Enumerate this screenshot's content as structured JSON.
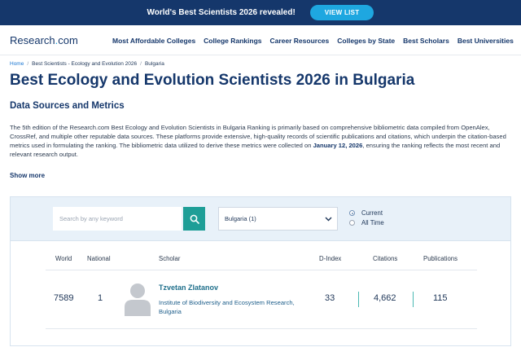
{
  "banner": {
    "text": "World's Best Scientists 2026 revealed!",
    "button_label": "VIEW LIST"
  },
  "header": {
    "logo_main": "Research",
    "logo_dot": ".",
    "logo_suffix": "com",
    "nav": [
      "Most Affordable Colleges",
      "College Rankings",
      "Career Resources",
      "Colleges by State",
      "Best Scholars",
      "Best Universities"
    ]
  },
  "breadcrumb": {
    "home": "Home",
    "separator": "/",
    "level2": "Best Scientists - Ecology and Evolution 2026",
    "level3": "Bulgaria"
  },
  "page_title": "Best Ecology and Evolution Scientists 2026 in Bulgaria",
  "section_title": "Data Sources and Metrics",
  "description": {
    "part1": "The 5th edition of the Research.com Best Ecology and Evolution Scientists in Bulgaria Ranking is primarily based on comprehensive bibliometric data compiled from OpenAlex, CrossRef, and multiple other reputable data sources. These platforms provide extensive, high-quality records of scientific publications and citations, which underpin the citation-based metrics used in formulating the ranking. The bibliometric data utilized to derive these metrics were collected on ",
    "date": "January 12, 2026",
    "part2": ", ensuring the ranking reflects the most recent and relevant research output."
  },
  "show_more": "Show more",
  "filters": {
    "search_placeholder": "Search by any keyword",
    "country_value": "Bulgaria (1)",
    "radio_current": "Current",
    "radio_all_time": "All Time",
    "selected": "Current"
  },
  "table": {
    "headers": {
      "world": "World",
      "national": "National",
      "scholar": "Scholar",
      "dindex": "D-Index",
      "citations": "Citations",
      "publications": "Publications"
    },
    "rows": [
      {
        "world": "7589",
        "national": "1",
        "name": "Tzvetan Zlatanov",
        "institution": "Institute of Biodiversity and Ecosystem Research, Bulgaria",
        "dindex": "33",
        "citations": "4,662",
        "publications": "115"
      }
    ]
  },
  "icons": {
    "search": "search-icon",
    "chevron": "chevron-down-icon",
    "avatar": "avatar-placeholder-icon"
  },
  "colors": {
    "banner_bg": "#15376b",
    "accent": "#1ea7e0",
    "search_button": "#1e9e97",
    "panel_bg": "#e8f1f9"
  }
}
